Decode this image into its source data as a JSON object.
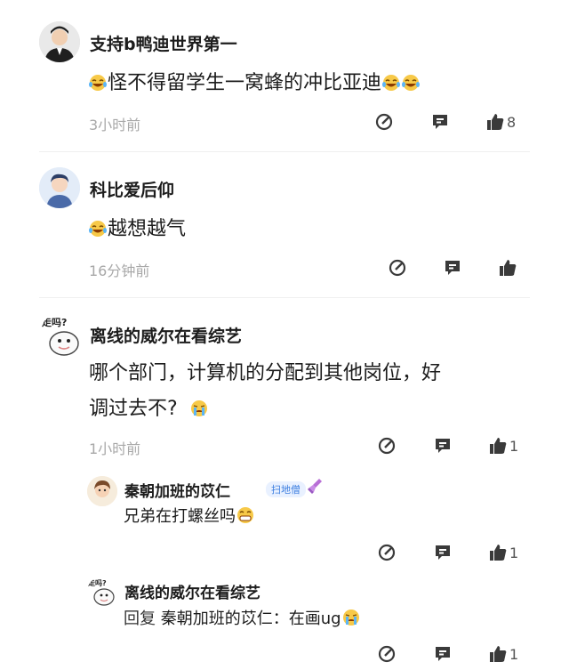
{
  "comments": [
    {
      "user": "支持b鸭迪世界第一",
      "text": "怪不得留学生一窝蜂的冲比亚迪",
      "time": "3小时前",
      "likes": "8"
    },
    {
      "user": "科比爱后仰",
      "text": "越想越气",
      "time": "16分钟前",
      "likes": ""
    },
    {
      "user": "离线的威尔在看综艺",
      "text_line1": "哪个部门，计算机的分配到其他岗位，好",
      "text_line2": "调过去不?",
      "time": "1小时前",
      "likes": "1",
      "avatar_tag": "走吗?"
    }
  ],
  "replies": [
    {
      "user": "秦朝加班的苡仁",
      "badge": "扫地僧",
      "text": "兄弟在打螺丝吗",
      "likes": "1"
    },
    {
      "user": "离线的威尔在看综艺",
      "reply_prefix": "回复",
      "reply_to": "秦朝加班的苡仁",
      "text": "：在画ug",
      "likes": "1"
    }
  ],
  "colors": {
    "icon": "#3a3a3a",
    "time": "#a8a8a8",
    "badge": "#3d7fe0"
  },
  "icons": [
    "edit-icon",
    "message-icon",
    "thumbs-up-icon",
    "laughing-emoji-icon",
    "crying-emoji-icon",
    "grin-emoji-icon"
  ]
}
